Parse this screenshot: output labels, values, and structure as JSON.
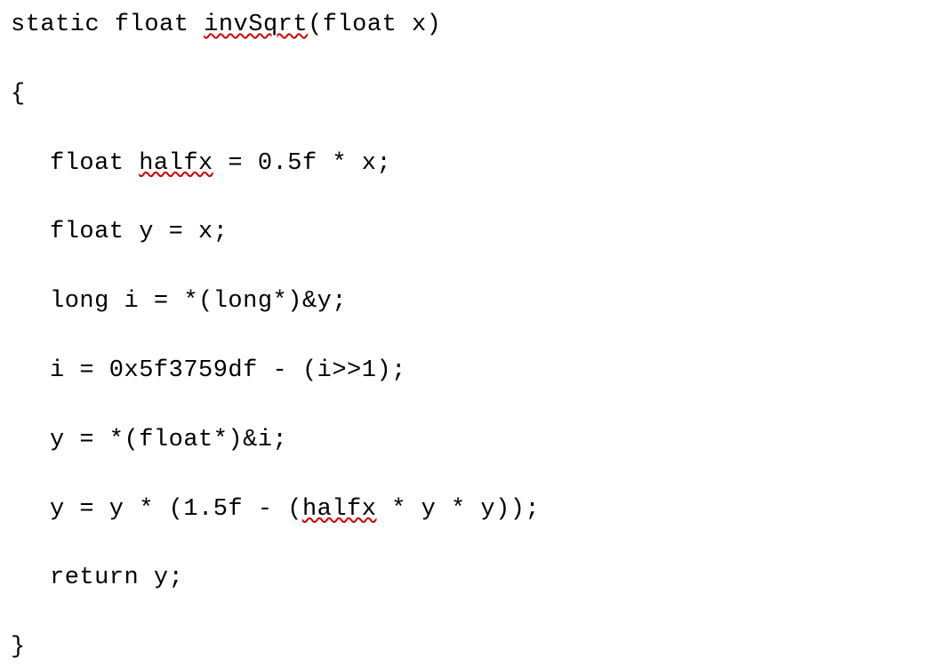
{
  "code": {
    "lines": [
      {
        "indent": false,
        "segments": [
          {
            "text": "static float ",
            "err": false
          },
          {
            "text": "invSqrt",
            "err": true
          },
          {
            "text": "(float x)",
            "err": false
          }
        ]
      },
      {
        "indent": false,
        "segments": [
          {
            "text": "{",
            "err": false
          }
        ]
      },
      {
        "indent": true,
        "segments": [
          {
            "text": "float ",
            "err": false
          },
          {
            "text": "halfx",
            "err": true
          },
          {
            "text": " = 0.5f * x;",
            "err": false
          }
        ]
      },
      {
        "indent": true,
        "segments": [
          {
            "text": "float y = x;",
            "err": false
          }
        ]
      },
      {
        "indent": true,
        "segments": [
          {
            "text": "long i = *(long*)&y;",
            "err": false
          }
        ]
      },
      {
        "indent": true,
        "segments": [
          {
            "text": "i = 0x5f3759df - (i>>1);",
            "err": false
          }
        ]
      },
      {
        "indent": true,
        "segments": [
          {
            "text": "y = *(float*)&i;",
            "err": false
          }
        ]
      },
      {
        "indent": true,
        "segments": [
          {
            "text": "y = y * (1.5f - (",
            "err": false
          },
          {
            "text": "halfx",
            "err": true
          },
          {
            "text": " * y * y));",
            "err": false
          }
        ]
      },
      {
        "indent": true,
        "segments": [
          {
            "text": "return y;",
            "err": false
          }
        ]
      },
      {
        "indent": false,
        "segments": [
          {
            "text": "}",
            "err": false
          }
        ]
      }
    ]
  }
}
